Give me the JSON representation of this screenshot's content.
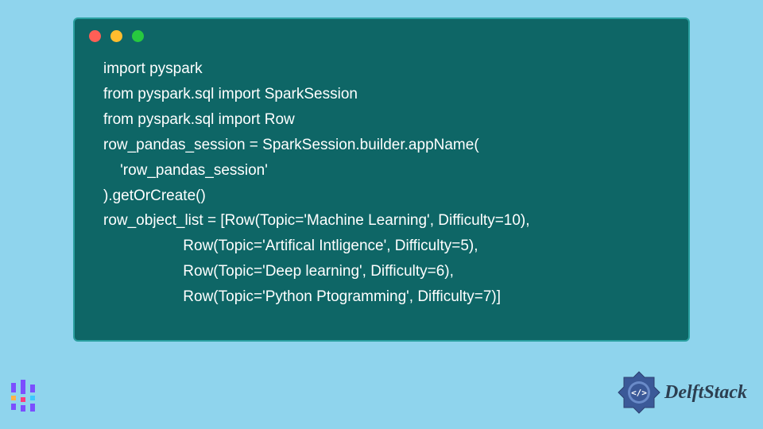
{
  "code": {
    "lines": [
      "import pyspark",
      "from pyspark.sql import SparkSession",
      "from pyspark.sql import Row",
      "row_pandas_session = SparkSession.builder.appName(",
      "    'row_pandas_session'",
      ").getOrCreate()",
      "row_object_list = [Row(Topic='Machine Learning', Difficulty=10),",
      "                   Row(Topic='Artifical Intligence', Difficulty=5),",
      "                   Row(Topic='Deep learning', Difficulty=6),",
      "                   Row(Topic='Python Ptogramming', Difficulty=7)]"
    ]
  },
  "branding": {
    "right_text": "DelftStack"
  },
  "colors": {
    "background": "#8fd4ed",
    "code_bg": "#0e6666",
    "code_text": "#ffffff",
    "dot_red": "#ff5f56",
    "dot_yellow": "#ffbd2e",
    "dot_green": "#27c93f",
    "brand_blue": "#3b5998"
  }
}
